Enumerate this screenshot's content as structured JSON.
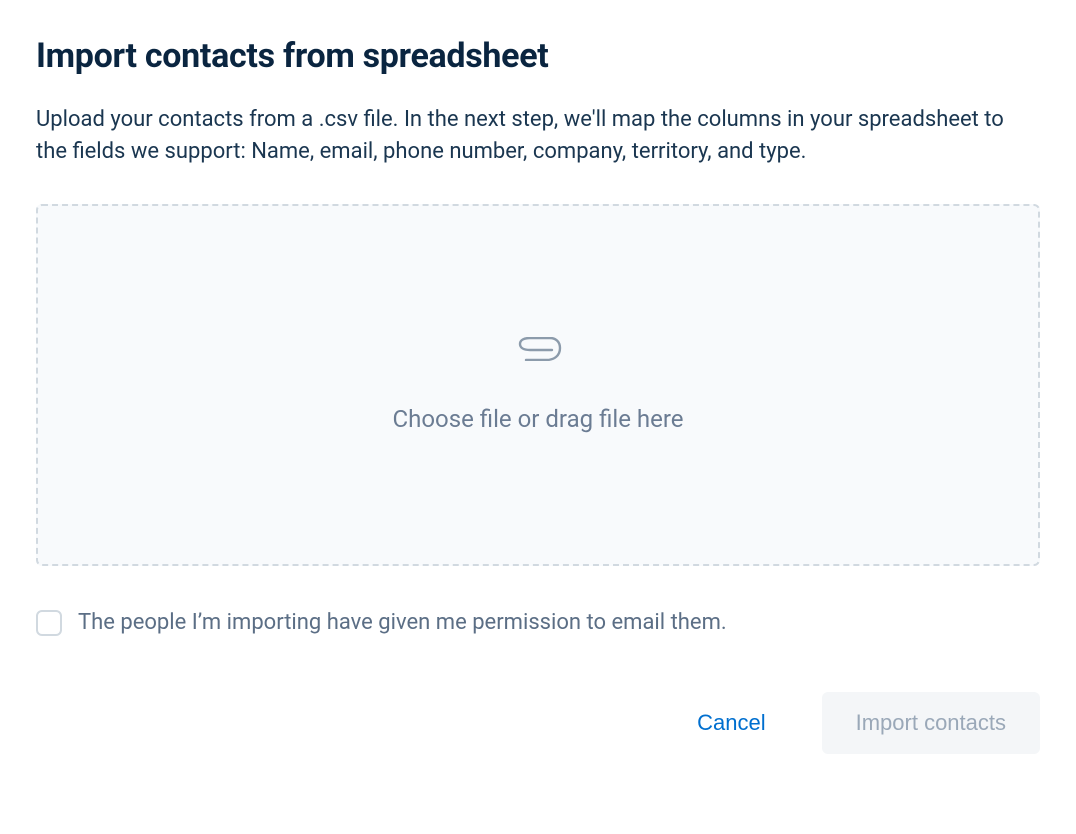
{
  "dialog": {
    "title": "Import contacts from spreadsheet",
    "description": "Upload your contacts from a .csv file. In the next step, we'll map the columns in your spreadsheet to the fields we support: Name, email, phone number, company, territory, and type."
  },
  "dropzone": {
    "text": "Choose file or drag file here",
    "icon": "paperclip-icon"
  },
  "consent": {
    "checked": false,
    "label": "The people I’m importing have given me permission to email them."
  },
  "actions": {
    "cancel_label": "Cancel",
    "import_label": "Import contacts",
    "import_enabled": false
  }
}
